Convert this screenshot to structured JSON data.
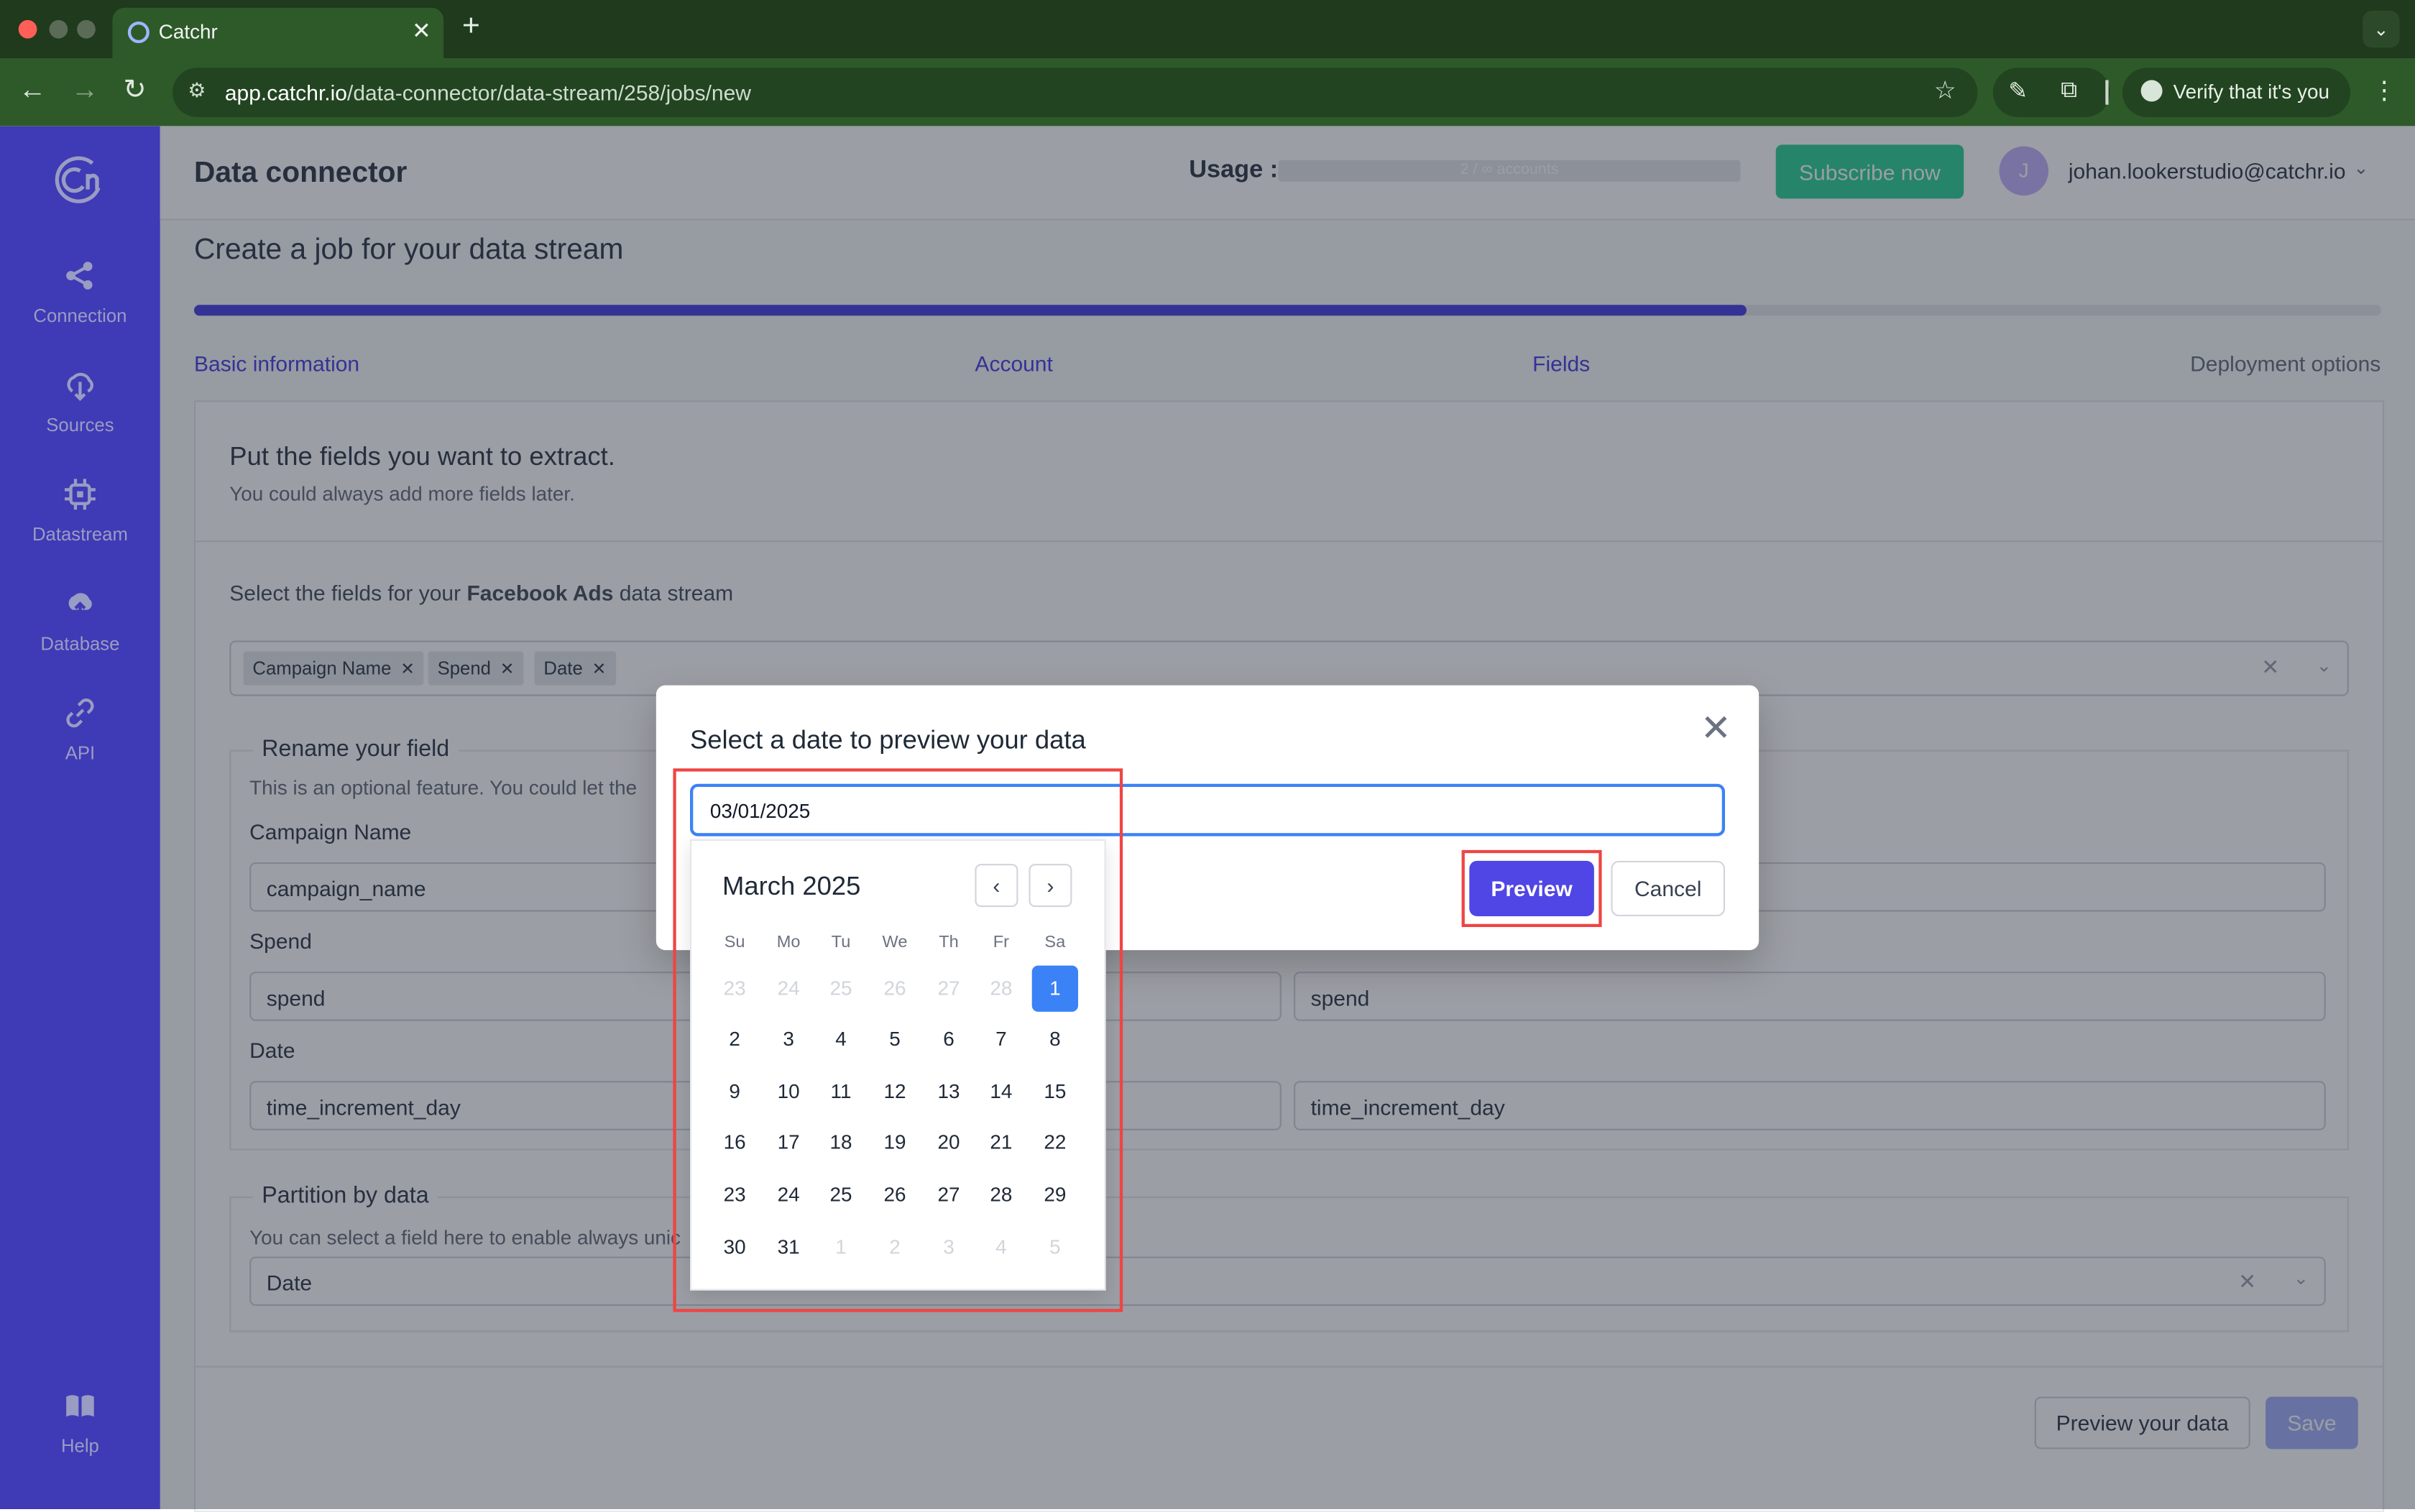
{
  "browser": {
    "tab_title": "Catchr",
    "url_host": "app.catchr.io",
    "url_path": "/data-connector/data-stream/258/jobs/new",
    "verify_label": "Verify that it's you"
  },
  "sidebar": {
    "items": [
      {
        "label": "Connection",
        "icon": "share-icon"
      },
      {
        "label": "Sources",
        "icon": "cloud-download-icon"
      },
      {
        "label": "Datastream",
        "icon": "chip-icon"
      },
      {
        "label": "Database",
        "icon": "cloud-upload-icon"
      },
      {
        "label": "API",
        "icon": "link-icon"
      }
    ],
    "help_label": "Help"
  },
  "header": {
    "title": "Data connector",
    "usage_label": "Usage :",
    "usage_bar_text": "2 / ∞ accounts",
    "subscribe_label": "Subscribe now",
    "avatar_initial": "J",
    "user_email": "johan.lookerstudio@catchr.io"
  },
  "page": {
    "title": "Create a job for your data stream",
    "progress_percent": 71,
    "steps": [
      "Basic information",
      "Account",
      "Fields",
      "Deployment options"
    ]
  },
  "card": {
    "heading": "Put the fields you want to extract.",
    "subheading": "You could always add more fields later.",
    "select_prefix": "Select the fields for your ",
    "select_source": "Facebook Ads",
    "select_suffix": " data stream",
    "chips": [
      "Campaign Name",
      "Spend",
      "Date"
    ],
    "rename_legend": "Rename your field",
    "rename_sub": "This is an optional feature. You could let the",
    "fields": [
      {
        "label": "Campaign Name",
        "original": "campaign_name",
        "renamed": ""
      },
      {
        "label": "Spend",
        "original": "spend",
        "renamed": "spend"
      },
      {
        "label": "Date",
        "original": "time_increment_day",
        "renamed": "time_increment_day"
      }
    ],
    "partition_legend": "Partition by data",
    "partition_sub": "You can select a field here to enable always unic",
    "partition_value": "Date",
    "preview_data_label": "Preview your data",
    "save_label": "Save"
  },
  "modal": {
    "title": "Select a date to preview your data",
    "date_value": "03/01/2025",
    "preview_label": "Preview",
    "cancel_label": "Cancel"
  },
  "calendar": {
    "month_label": "March 2025",
    "weekdays": [
      "Su",
      "Mo",
      "Tu",
      "We",
      "Th",
      "Fr",
      "Sa"
    ],
    "weeks": [
      [
        "23",
        "24",
        "25",
        "26",
        "27",
        "28",
        "1"
      ],
      [
        "2",
        "3",
        "4",
        "5",
        "6",
        "7",
        "8"
      ],
      [
        "9",
        "10",
        "11",
        "12",
        "13",
        "14",
        "15"
      ],
      [
        "16",
        "17",
        "18",
        "19",
        "20",
        "21",
        "22"
      ],
      [
        "23",
        "24",
        "25",
        "26",
        "27",
        "28",
        "29"
      ],
      [
        "30",
        "31",
        "1",
        "2",
        "3",
        "4",
        "5"
      ]
    ],
    "selected_day": "1"
  },
  "colors": {
    "accent": "#4f46e5",
    "selected_day": "#3b82f6",
    "highlight": "#ef4444"
  }
}
